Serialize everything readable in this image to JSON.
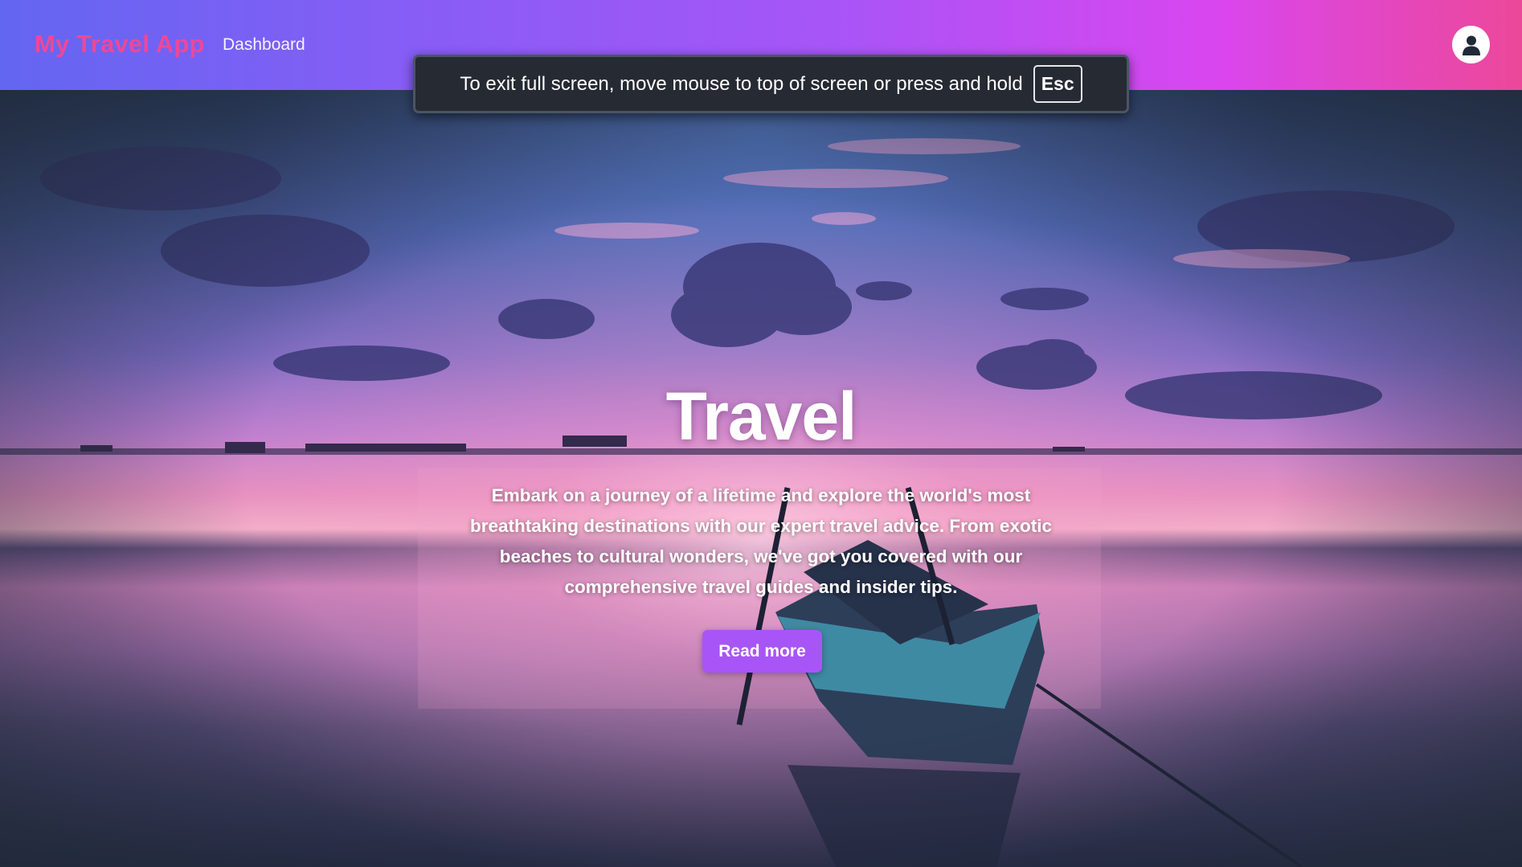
{
  "navbar": {
    "brand": "My Travel App",
    "links": [
      "Dashboard"
    ],
    "avatar_icon": "user-icon"
  },
  "fullscreen_notice": {
    "text": "To exit full screen, move mouse to top of screen or press and hold",
    "key": "Esc"
  },
  "hero": {
    "title": "Travel",
    "description": "Embark on a journey of a lifetime and explore the world's most breathtaking destinations with our expert travel advice. From exotic beaches to cultural wonders, we've got you covered with our comprehensive travel guides and insider tips.",
    "button_label": "Read more",
    "background_image": "sunset-lake-boat"
  },
  "colors": {
    "brand_text": "#ec4899",
    "navbar_gradient_start": "#6366f1",
    "navbar_gradient_end": "#ec4899",
    "button": "#a855f7"
  }
}
